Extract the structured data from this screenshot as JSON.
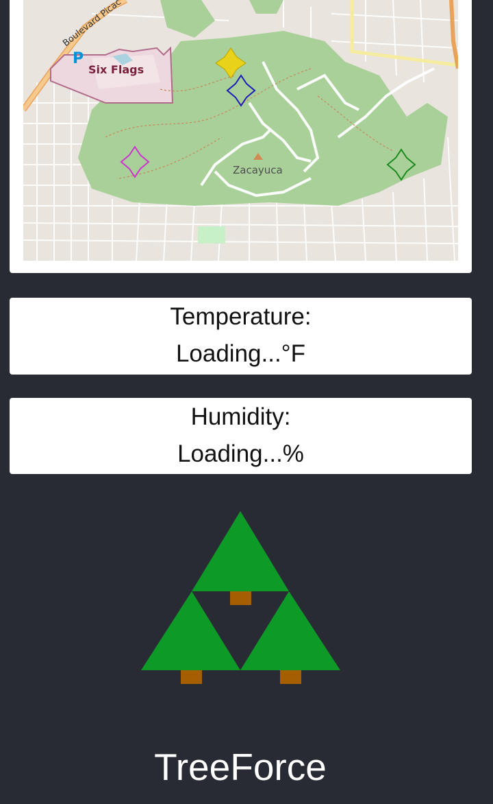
{
  "map": {
    "labels": {
      "road": "Boulevard Picac",
      "parking": "P",
      "park_attraction": "Six Flags",
      "area": "Zacayuca"
    },
    "markers": [
      {
        "name": "yellow-marker",
        "color": "#e8d21a"
      },
      {
        "name": "blue-marker",
        "color": "#1a1ab8"
      },
      {
        "name": "magenta-marker",
        "color": "#cc33cc"
      },
      {
        "name": "green-marker",
        "color": "#1a8a1a"
      }
    ]
  },
  "temperature": {
    "label": "Temperature:",
    "value": "Loading...°F"
  },
  "humidity": {
    "label": "Humidity:",
    "value": "Loading...%"
  },
  "logo": {
    "tree_color": "#0e9a27",
    "trunk_color": "#a65f00"
  },
  "app": {
    "name": "TreeForce"
  }
}
